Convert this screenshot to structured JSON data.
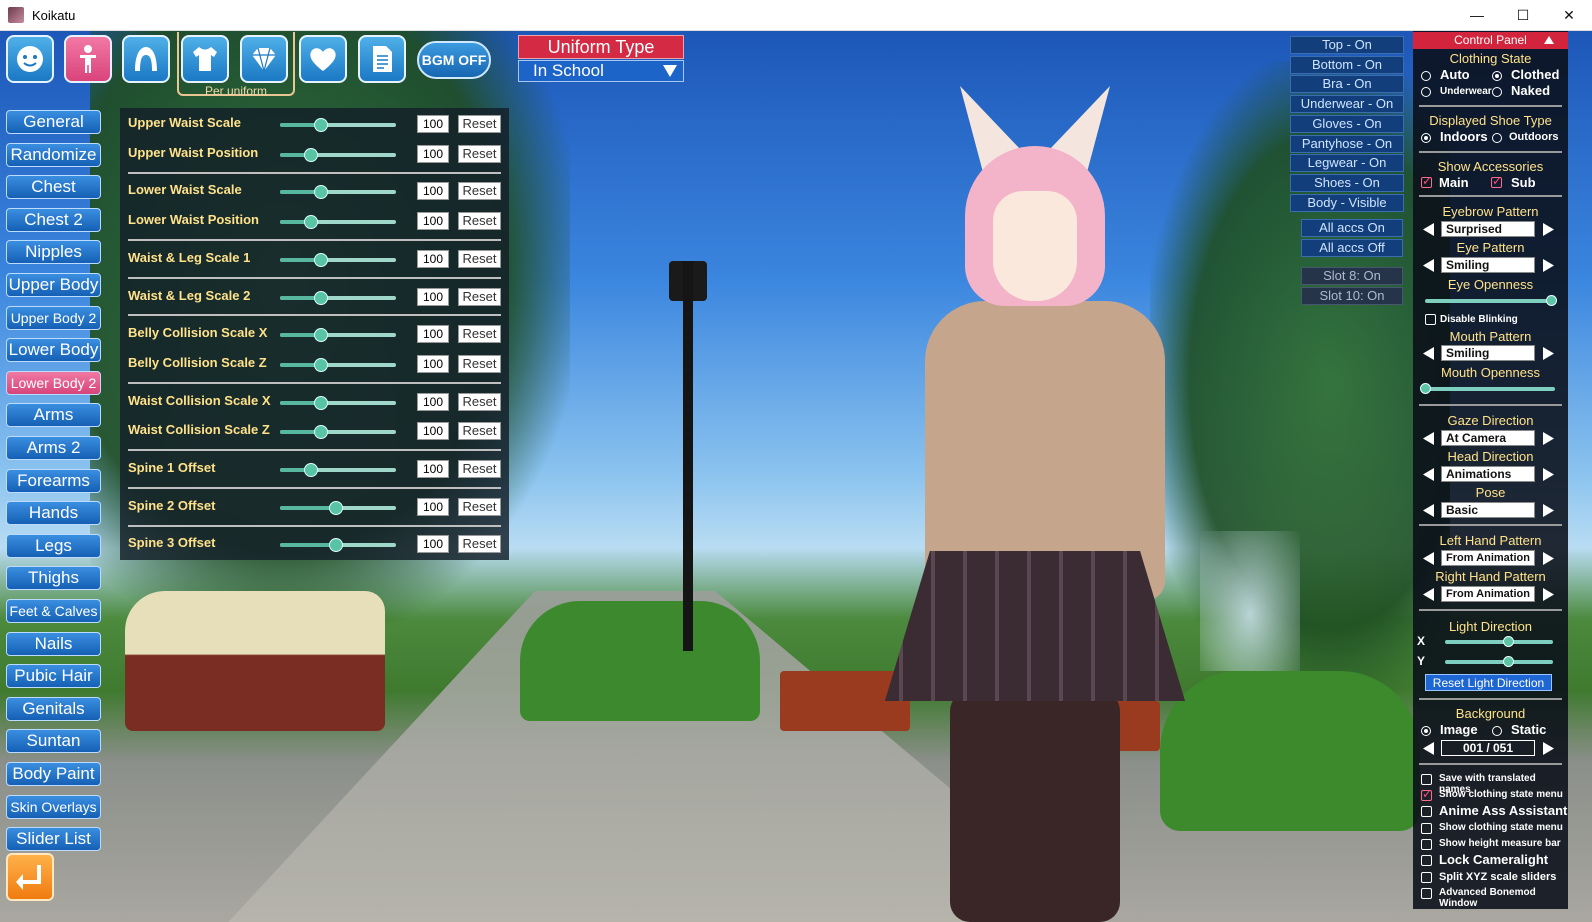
{
  "window": {
    "title": "Koikatu",
    "minimize": "—",
    "maximize": "☐",
    "close": "✕"
  },
  "toolbar": {
    "icons": [
      "face-icon",
      "body-icon",
      "hair-icon",
      "clothes-icon",
      "accessory-icon",
      "heart-icon",
      "document-icon"
    ],
    "bgm_label": "BGM OFF",
    "per_uniform_label": "Per uniform"
  },
  "uniform": {
    "title": "Uniform Type",
    "selected": "In School"
  },
  "nav": [
    "General",
    "Randomize",
    "Chest",
    "Chest 2",
    "Nipples",
    "Upper Body",
    "Upper Body 2",
    "Lower Body",
    "Lower Body 2",
    "Arms",
    "Arms 2",
    "Forearms",
    "Hands",
    "Legs",
    "Thighs",
    "Feet & Calves",
    "Nails",
    "Pubic Hair",
    "Genitals",
    "Suntan",
    "Body Paint",
    "Skin Overlays",
    "Slider List"
  ],
  "nav_active": "Lower Body 2",
  "sliders": {
    "reset_label": "Reset",
    "items": [
      {
        "label": "Upper Waist Scale",
        "value": "100",
        "level": 0.35
      },
      {
        "label": "Upper Waist Position",
        "value": "100",
        "level": 0.27
      },
      {
        "label": "Lower Waist Scale",
        "value": "100",
        "level": 0.35
      },
      {
        "label": "Lower Waist Position",
        "value": "100",
        "level": 0.27
      },
      {
        "label": "Waist & Leg Scale 1",
        "value": "100",
        "level": 0.35
      },
      {
        "label": "Waist & Leg Scale 2",
        "value": "100",
        "level": 0.35
      },
      {
        "label": "Belly Collision Scale X",
        "value": "100",
        "level": 0.35
      },
      {
        "label": "Belly Collision Scale Z",
        "value": "100",
        "level": 0.35
      },
      {
        "label": "Waist Collision Scale X",
        "value": "100",
        "level": 0.35
      },
      {
        "label": "Waist Collision Scale Z",
        "value": "100",
        "level": 0.35
      },
      {
        "label": "Spine 1 Offset",
        "value": "100",
        "level": 0.27
      },
      {
        "label": "Spine 2 Offset",
        "value": "100",
        "level": 0.48
      },
      {
        "label": "Spine 3 Offset",
        "value": "100",
        "level": 0.48
      }
    ]
  },
  "clothing_toggles": [
    "Top - On",
    "Bottom - On",
    "Bra - On",
    "Underwear - On",
    "Gloves - On",
    "Pantyhose - On",
    "Legwear - On",
    "Shoes - On",
    "Body - Visible"
  ],
  "accessory_toggles": [
    "All accs On",
    "All accs Off"
  ],
  "slot_toggles": [
    "Slot 8: On",
    "Slot 10: On"
  ],
  "control_panel": {
    "header": "Control Panel",
    "clothing_state": {
      "title": "Clothing State",
      "options": [
        "Auto",
        "Clothed",
        "Underwear",
        "Naked"
      ],
      "selected": "Clothed"
    },
    "shoe_type": {
      "title": "Displayed Shoe Type",
      "options": [
        "Indoors",
        "Outdoors"
      ],
      "selected": "Indoors"
    },
    "accessories": {
      "title": "Show Accessories",
      "main": "Main",
      "sub": "Sub"
    },
    "eyebrow": {
      "title": "Eyebrow Pattern",
      "value": "Surprised"
    },
    "eye": {
      "title": "Eye Pattern",
      "value": "Smiling"
    },
    "eye_openness": {
      "title": "Eye Openness",
      "level": 0.97
    },
    "disable_blinking": "Disable Blinking",
    "mouth": {
      "title": "Mouth Pattern",
      "value": "Smiling"
    },
    "mouth_openness": {
      "title": "Mouth Openness",
      "level": 0.0
    },
    "gaze": {
      "title": "Gaze Direction",
      "value": "At Camera"
    },
    "head": {
      "title": "Head Direction",
      "value": "Animations"
    },
    "pose": {
      "title": "Pose",
      "value": "Basic"
    },
    "left_hand": {
      "title": "Left Hand Pattern",
      "value": "From Animation"
    },
    "right_hand": {
      "title": "Right Hand Pattern",
      "value": "From Animation"
    },
    "light": {
      "title": "Light Direction",
      "x_label": "X",
      "y_label": "Y",
      "x_level": 0.58,
      "y_level": 0.58,
      "reset": "Reset Light Direction"
    },
    "background": {
      "title": "Background",
      "options": [
        "Image",
        "Static"
      ],
      "selected": "Image",
      "counter": "001 / 051"
    },
    "options": [
      {
        "label": "Save with translated names",
        "checked": false,
        "size": "xs"
      },
      {
        "label": "Show clothing state menu",
        "checked": true,
        "size": "xs"
      },
      {
        "label": "Anime Ass Assistant",
        "checked": false,
        "size": "md"
      },
      {
        "label": "Show clothing state menu",
        "checked": false,
        "size": "xs"
      },
      {
        "label": "Show height measure bar",
        "checked": false,
        "size": "xs"
      },
      {
        "label": "Lock Cameralight",
        "checked": false,
        "size": "md"
      },
      {
        "label": "Split XYZ scale sliders",
        "checked": false,
        "size": "sm"
      },
      {
        "label": "Advanced Bonemod Window",
        "checked": false,
        "size": "xs"
      }
    ]
  },
  "colors": {
    "accent_red": "#d2253d",
    "button_blue": "#1560b5",
    "active_pink": "#d64479",
    "label_yellow": "#ffe28a"
  }
}
